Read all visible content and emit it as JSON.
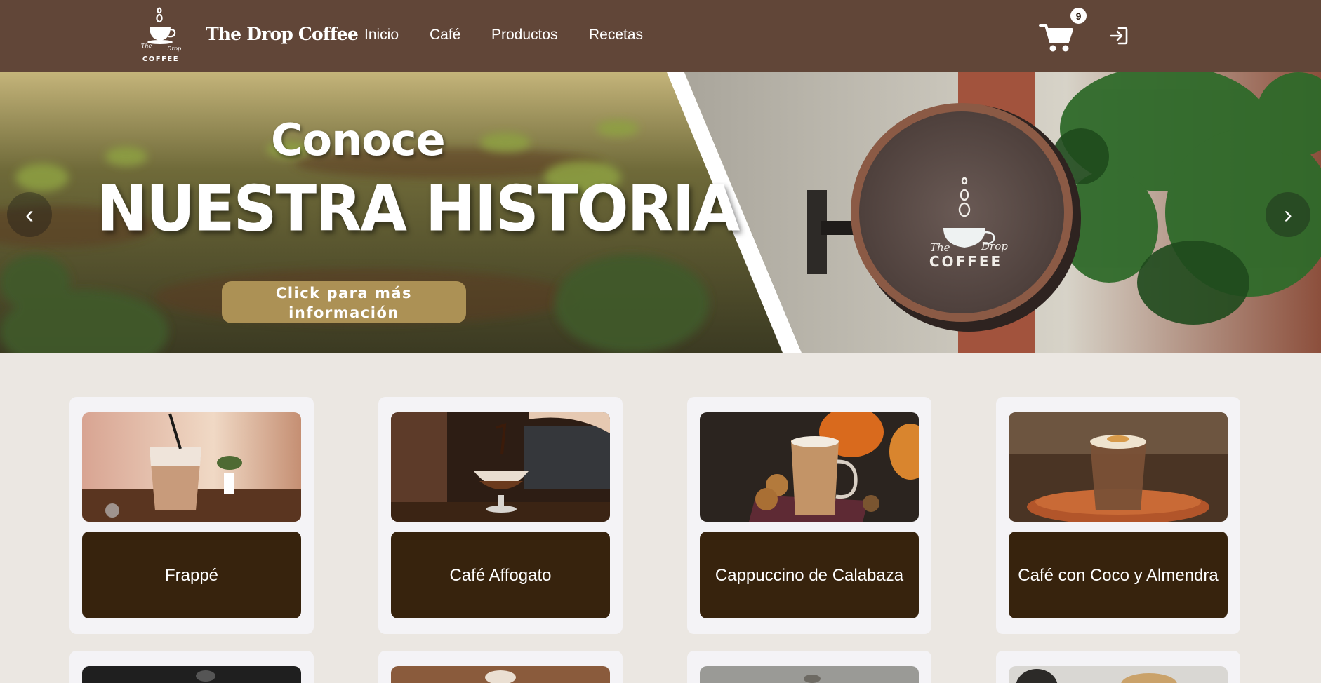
{
  "header": {
    "brand": "The Drop Coffee",
    "logo_text_top": "The",
    "logo_text_right": "Drop",
    "logo_text_bottom": "COFFEE",
    "nav": [
      {
        "label": "Inicio"
      },
      {
        "label": "Café"
      },
      {
        "label": "Productos"
      },
      {
        "label": "Recetas"
      }
    ],
    "cart_count": "9",
    "cart_icon": "cart-icon",
    "login_icon": "login-icon"
  },
  "hero": {
    "kicker": "Conoce",
    "title": "NUESTRA HISTORIA",
    "cta_line1": "Click para más",
    "cta_line2": "información",
    "sign_text_the": "The",
    "sign_text_drop": "Drop",
    "sign_text_coffee": "COFFEE",
    "prev": "‹",
    "next": "›"
  },
  "products": [
    {
      "name": "Frappé"
    },
    {
      "name": "Café Affogato"
    },
    {
      "name": "Cappuccino de Calabaza"
    },
    {
      "name": "Café con Coco y Almendra"
    }
  ],
  "colors": {
    "navbar": "#614638",
    "page_bg": "#ebe7e2",
    "card_bg": "#f4f3f6",
    "card_button": "#37230d",
    "cta": "#ac9155"
  }
}
